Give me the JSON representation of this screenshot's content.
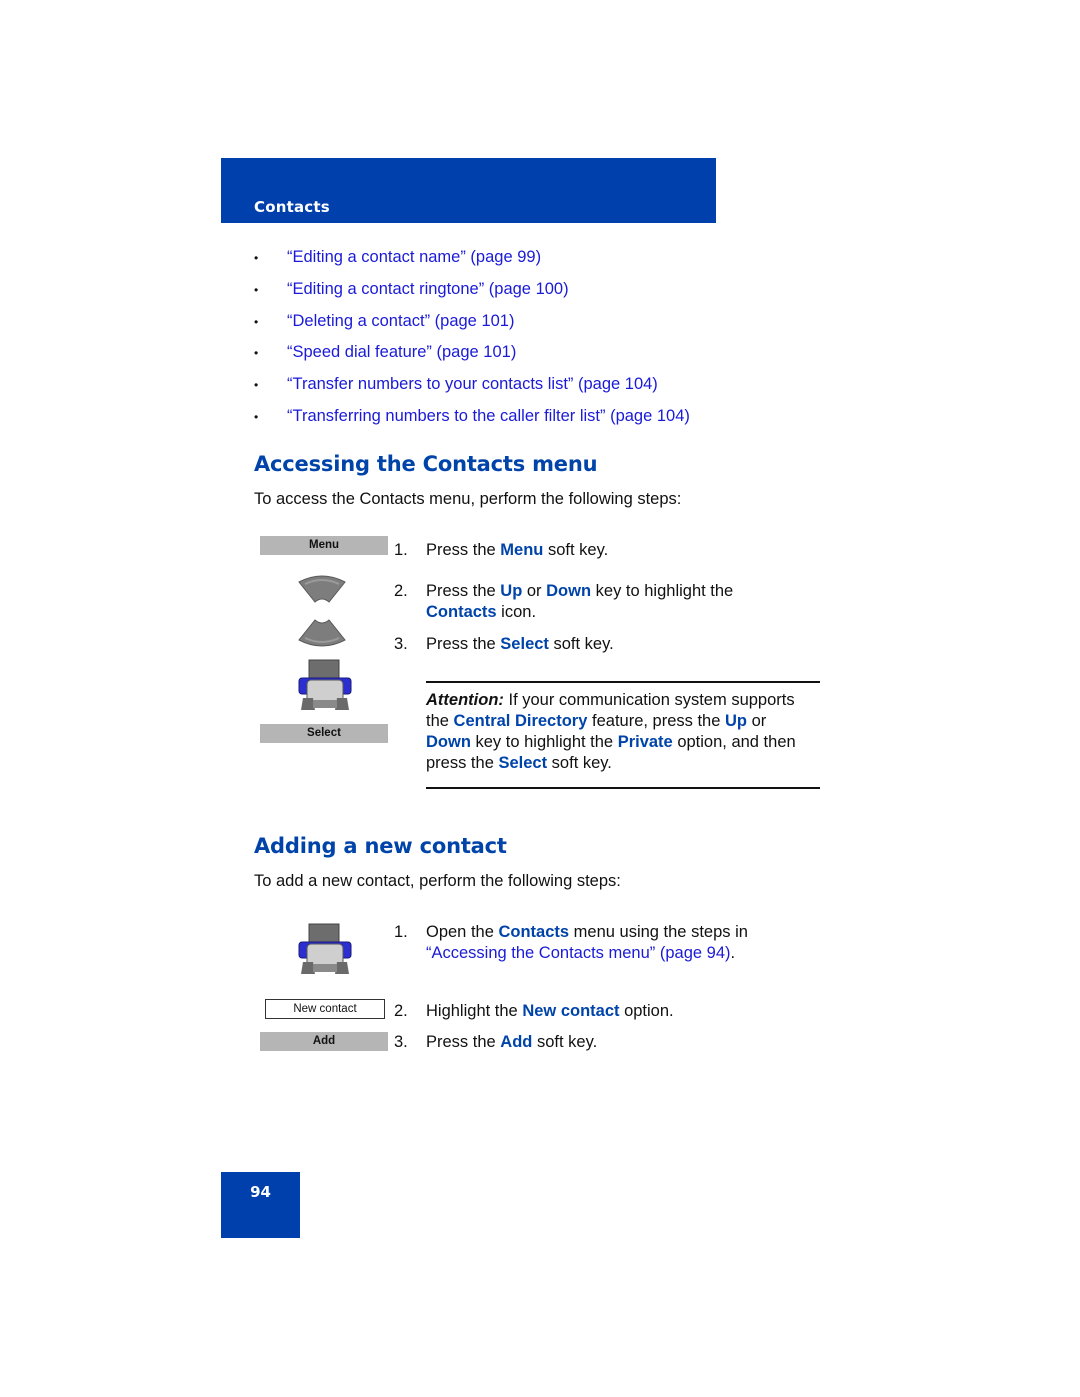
{
  "header": {
    "section_title": "Contacts"
  },
  "related_links": [
    {
      "text": "“Editing a contact name” (page 99)"
    },
    {
      "text": "“Editing a contact ringtone” (page 100)"
    },
    {
      "text": "“Deleting a contact” (page 101)"
    },
    {
      "text": "“Speed dial feature” (page 101)"
    },
    {
      "text": "“Transfer numbers to your contacts list” (page 104)"
    },
    {
      "text": "“Transferring numbers to the caller filter list” (page 104)"
    }
  ],
  "bullet": "•",
  "section_access": {
    "heading": "Accessing the Contacts menu",
    "intro": "To access the Contacts menu, perform the following steps:",
    "icons": {
      "menu_softkey": "Menu",
      "up_key": "up-key-icon",
      "down_key": "down-key-icon",
      "contacts_icon": "contacts-icon",
      "select_softkey": "Select"
    },
    "steps": [
      {
        "num": "1.",
        "parts": [
          "Press the ",
          "Menu",
          " soft key."
        ]
      },
      {
        "num": "2.",
        "parts": [
          "Press the ",
          "Up",
          " or ",
          "Down",
          " key to highlight the"
        ],
        "cont": [
          "Contacts",
          " icon."
        ]
      },
      {
        "num": "3.",
        "parts": [
          "Press the ",
          "Select",
          " soft key."
        ]
      }
    ],
    "attention": {
      "label": "Attention:",
      "l1": " If your communication system supports",
      "l2a": "the ",
      "l2b": "Central Directory",
      "l2c": " feature, press the ",
      "l2d": "Up",
      "l2e": " or",
      "l3a": "Down",
      "l3b": " key to highlight the ",
      "l3c": "Private",
      "l3d": " option, and then",
      "l4a": "press the ",
      "l4b": "Select",
      "l4c": " soft key."
    }
  },
  "section_add": {
    "heading": "Adding a new contact",
    "intro": "To add a new contact, perform the following steps:",
    "icons": {
      "contacts_icon": "contacts-icon",
      "new_contact_option": "New contact",
      "add_softkey": "Add"
    },
    "steps": [
      {
        "num": "1.",
        "a": "Open the ",
        "b": "Contacts",
        "c": " menu using the steps in",
        "link": "“Accessing the Contacts menu” (page 94)",
        "end": "."
      },
      {
        "num": "2.",
        "a": "Highlight the ",
        "b": "New contact",
        "c": " option."
      },
      {
        "num": "3.",
        "a": "Press the ",
        "b": "Add",
        "c": " soft key."
      }
    ]
  },
  "footer": {
    "page_number": "94"
  },
  "colors": {
    "brand_blue": "#0040ac",
    "link_blue": "#1a1ad8",
    "emphasis_blue": "#0044aa",
    "softkey_gray": "#b5b5b5"
  }
}
